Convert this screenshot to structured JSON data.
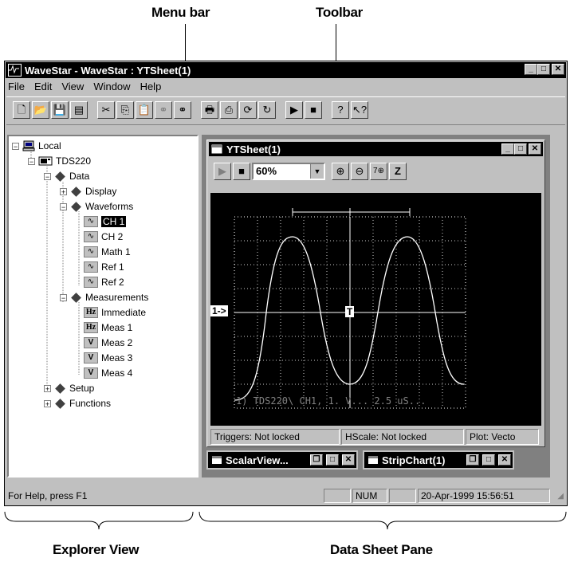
{
  "callouts": {
    "menu_bar": "Menu bar",
    "toolbar": "Toolbar",
    "explorer_view": "Explorer View",
    "data_sheet_pane": "Data Sheet Pane"
  },
  "window": {
    "title": "WaveStar - WaveStar : YTSheet(1)",
    "icon": "wavestar-app-icon"
  },
  "menu": [
    "File",
    "Edit",
    "View",
    "Window",
    "Help"
  ],
  "toolbar_icons": [
    "new-icon",
    "open-icon",
    "save-icon",
    "save-all-icon",
    "cut-icon",
    "copy-icon",
    "paste-icon",
    "link-disabled-icon",
    "link-icon",
    "print-icon",
    "print-preview-icon",
    "refresh-icon",
    "refresh-all-icon",
    "run-icon",
    "stop-icon",
    "help-icon",
    "context-help-icon"
  ],
  "explorer": {
    "items": [
      {
        "label": "Local",
        "icon": "computer-icon"
      },
      {
        "label": "TDS220",
        "icon": "instrument-icon"
      },
      {
        "label": "Data",
        "icon": "diamond-icon"
      },
      {
        "label": "Display",
        "icon": "diamond-icon"
      },
      {
        "label": "Waveforms",
        "icon": "diamond-icon"
      },
      {
        "label": "CH 1",
        "icon": "waveform-icon",
        "selected": true
      },
      {
        "label": "CH 2",
        "icon": "waveform-icon"
      },
      {
        "label": "Math 1",
        "icon": "waveform-icon"
      },
      {
        "label": "Ref 1",
        "icon": "waveform-icon"
      },
      {
        "label": "Ref 2",
        "icon": "waveform-icon"
      },
      {
        "label": "Measurements",
        "icon": "diamond-icon"
      },
      {
        "label": "Immediate",
        "icon": "hz-icon"
      },
      {
        "label": "Meas 1",
        "icon": "hz-icon"
      },
      {
        "label": "Meas 2",
        "icon": "v-icon"
      },
      {
        "label": "Meas 3",
        "icon": "v-icon"
      },
      {
        "label": "Meas 4",
        "icon": "v-icon"
      },
      {
        "label": "Setup",
        "icon": "diamond-icon"
      },
      {
        "label": "Functions",
        "icon": "diamond-icon"
      }
    ]
  },
  "ytsheet": {
    "title": "YTSheet(1)",
    "zoom": "60%",
    "channel_marker": "1->",
    "trigger_marker": "T",
    "scope_readout": "1) TDS220\\ CH1, 1. V... 2.5 uS...",
    "status": [
      "Triggers: Not locked",
      "HScale: Not locked",
      "Plot: Vecto"
    ]
  },
  "minimized_windows": [
    "ScalarView...",
    "StripChart(1)"
  ],
  "statusbar": {
    "help": "For Help, press F1",
    "num": "NUM",
    "datetime": "20-Apr-1999 15:56:51"
  }
}
